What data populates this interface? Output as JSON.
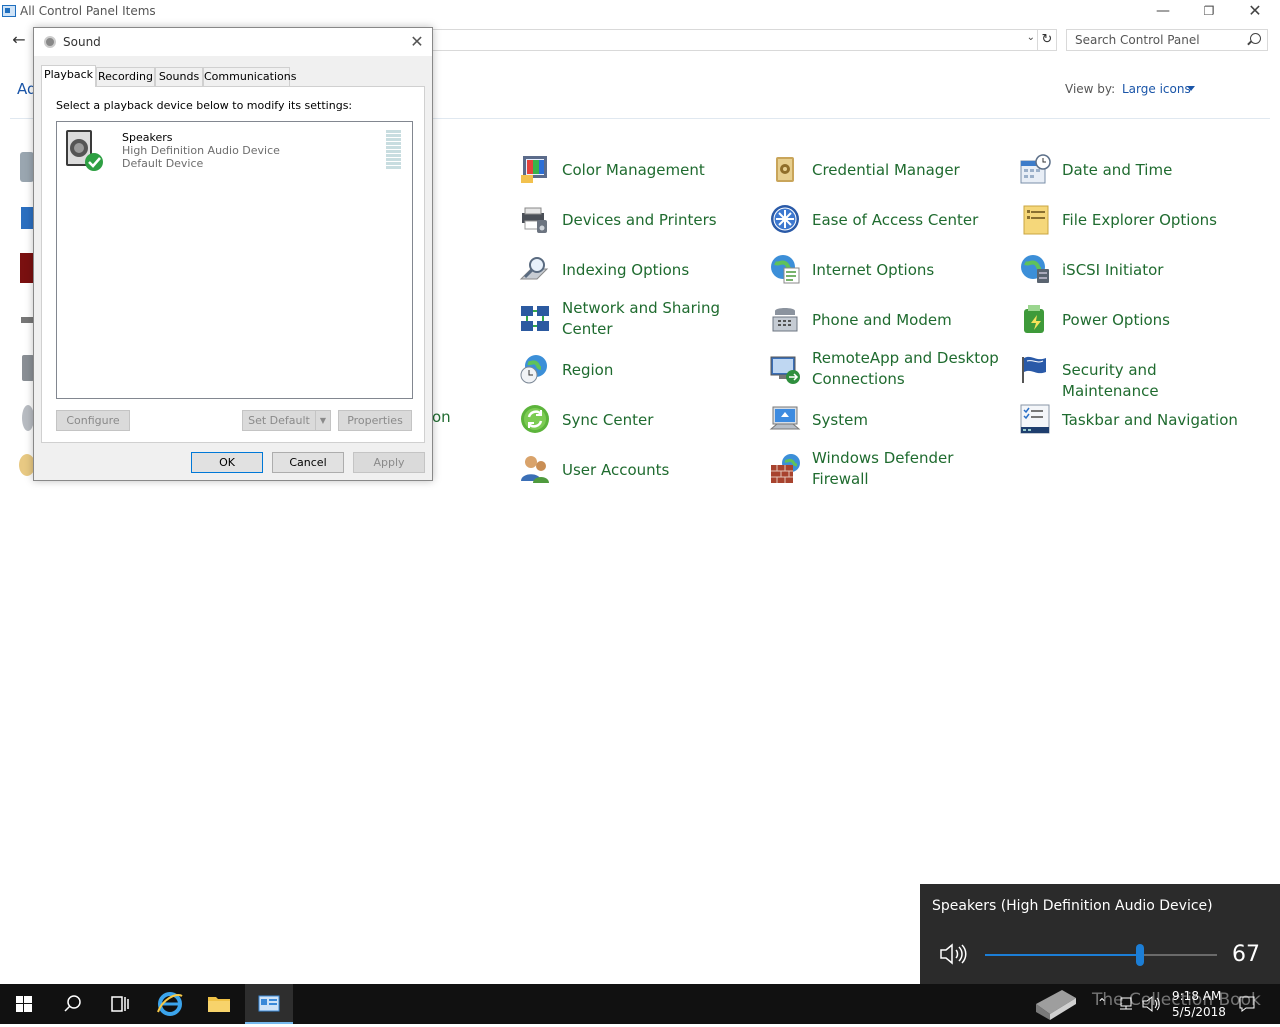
{
  "control_panel": {
    "title": "All Control Panel Items",
    "search_placeholder": "Search Control Panel",
    "adjust_text_fragment": "Ad",
    "view_by_label": "View by:",
    "view_by_value": "Large icons",
    "hidden_item_fragment": "on",
    "items": [
      {
        "label": "Color Management",
        "icon": "color-management-icon"
      },
      {
        "label": "Credential Manager",
        "icon": "credential-manager-icon"
      },
      {
        "label": "Date and Time",
        "icon": "date-time-icon"
      },
      {
        "label": "Devices and Printers",
        "icon": "devices-printers-icon"
      },
      {
        "label": "Ease of Access Center",
        "icon": "ease-of-access-icon"
      },
      {
        "label": "File Explorer Options",
        "icon": "file-explorer-options-icon"
      },
      {
        "label": "Indexing Options",
        "icon": "indexing-options-icon"
      },
      {
        "label": "Internet Options",
        "icon": "internet-options-icon"
      },
      {
        "label": "iSCSI Initiator",
        "icon": "iscsi-initiator-icon"
      },
      {
        "label": "Network and Sharing Center",
        "icon": "network-sharing-icon"
      },
      {
        "label": "Phone and Modem",
        "icon": "phone-modem-icon"
      },
      {
        "label": "Power Options",
        "icon": "power-options-icon"
      },
      {
        "label": "Region",
        "icon": "region-icon"
      },
      {
        "label": "RemoteApp and Desktop Connections",
        "icon": "remoteapp-icon"
      },
      {
        "label": "Security and Maintenance",
        "icon": "security-maintenance-icon"
      },
      {
        "label": "Sync Center",
        "icon": "sync-center-icon"
      },
      {
        "label": "System",
        "icon": "system-icon"
      },
      {
        "label": "Taskbar and Navigation",
        "icon": "taskbar-navigation-icon"
      },
      {
        "label": "User Accounts",
        "icon": "user-accounts-icon"
      },
      {
        "label": "Windows Defender Firewall",
        "icon": "firewall-icon"
      }
    ]
  },
  "sound_dialog": {
    "title": "Sound",
    "tabs": [
      "Playback",
      "Recording",
      "Sounds",
      "Communications"
    ],
    "active_tab": "Playback",
    "instruction": "Select a playback device below to modify its settings:",
    "device": {
      "name": "Speakers",
      "description": "High Definition Audio Device",
      "status": "Default Device"
    },
    "buttons": {
      "configure": "Configure",
      "set_default": "Set Default",
      "properties": "Properties",
      "ok": "OK",
      "cancel": "Cancel",
      "apply": "Apply"
    }
  },
  "volume_flyout": {
    "device_name": "Speakers (High Definition Audio Device)",
    "volume": 67
  },
  "taskbar": {
    "time": "9:18 AM",
    "date": "5/5/2018",
    "watermark": "The Collection Book"
  },
  "colors": {
    "link_green": "#1f6b2f",
    "link_blue": "#1a55a8",
    "accent": "#1c7ed6",
    "flyout_bg": "#2b2b2b",
    "taskbar_bg": "#111111"
  }
}
